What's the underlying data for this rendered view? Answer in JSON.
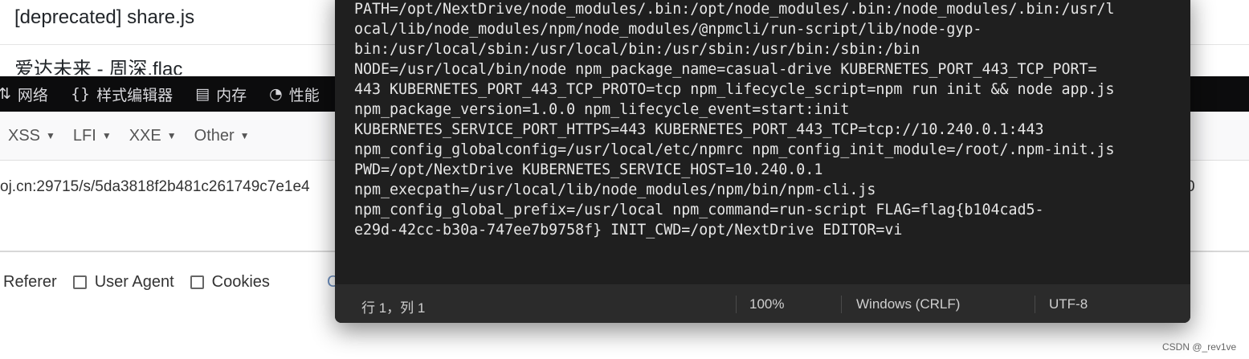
{
  "background_page": {
    "list_items": [
      "[deprecated] share.js",
      "爱达未来 - 周深.flac"
    ],
    "devtools_tabs": [
      {
        "icon": "network-icon",
        "glyph": "⇅",
        "label": "网络"
      },
      {
        "icon": "braces-icon",
        "glyph": "{}",
        "label": "样式编辑器"
      },
      {
        "icon": "memory-icon",
        "glyph": "▤",
        "label": "内存"
      },
      {
        "icon": "performance-icon",
        "glyph": "◔",
        "label": "性能"
      }
    ],
    "hackbar_buttons": [
      "XSS",
      "LFI",
      "XXE",
      "Other"
    ],
    "url_fragment": "oj.cn:29715/s/5da3818f2b481c261749c7e1e4",
    "url_right_fragment": "0",
    "checkboxes": [
      {
        "label": "Referer",
        "checked": null
      },
      {
        "label": "User Agent",
        "checked": false
      },
      {
        "label": "Cookies",
        "checked": false
      }
    ],
    "partial_text": "C"
  },
  "notepad": {
    "lines": [
      "PATH=/opt/NextDrive/node_modules/.bin:/opt/node_modules/.bin:/node_modules/.bin:/usr/l",
      "ocal/lib/node_modules/npm/node_modules/@npmcli/run-script/lib/node-gyp-",
      "bin:/usr/local/sbin:/usr/local/bin:/usr/sbin:/usr/bin:/sbin:/bin",
      "NODE=/usr/local/bin/node npm_package_name=casual-drive KUBERNETES_PORT_443_TCP_PORT=",
      "443 KUBERNETES_PORT_443_TCP_PROTO=tcp npm_lifecycle_script=npm run init && node app.js",
      "npm_package_version=1.0.0 npm_lifecycle_event=start:init",
      "KUBERNETES_SERVICE_PORT_HTTPS=443 KUBERNETES_PORT_443_TCP=tcp://10.240.0.1:443",
      "npm_config_globalconfig=/usr/local/etc/npmrc npm_config_init_module=/root/.npm-init.js",
      "PWD=/opt/NextDrive KUBERNETES_SERVICE_HOST=10.240.0.1",
      "npm_execpath=/usr/local/lib/node_modules/npm/bin/npm-cli.js",
      "npm_config_global_prefix=/usr/local npm_command=run-script FLAG=flag{b104cad5-",
      "e29d-42cc-b30a-747ee7b9758f} INIT_CWD=/opt/NextDrive EDITOR=vi"
    ],
    "status_bar": {
      "position": "行 1，列 1",
      "zoom": "100%",
      "line_ending": "Windows (CRLF)",
      "encoding": "UTF-8"
    }
  },
  "watermark": "CSDN @_rev1ve"
}
